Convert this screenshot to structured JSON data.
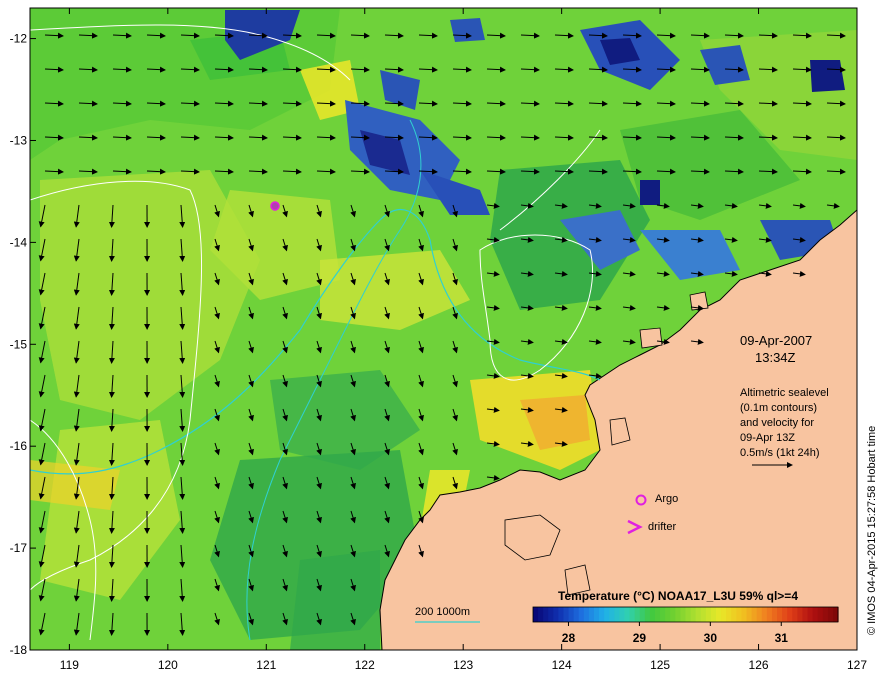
{
  "map": {
    "lon_ticks": [
      "119",
      "120",
      "121",
      "122",
      "123",
      "124",
      "125",
      "126",
      "127"
    ],
    "lat_ticks": [
      "-12",
      "-13",
      "-14",
      "-15",
      "-16",
      "-17",
      "-18"
    ],
    "lon_range": [
      118.6,
      127
    ],
    "lat_range": [
      -18,
      -11.7
    ]
  },
  "annotation": {
    "date": "09-Apr-2007",
    "time": "13:34Z",
    "info_lines": [
      "Altimetric sealevel",
      "(0.1m contours)",
      "and velocity for",
      "09-Apr 13Z",
      "0.5m/s (1kt 24h)"
    ]
  },
  "legend": {
    "argo_label": "Argo",
    "drifter_label": "drifter",
    "bathy_label": "200  1000m"
  },
  "colorbar": {
    "title": "Temperature (°C) NOAA17_L3U 59% ql>=4",
    "tick_labels": [
      "28",
      "29",
      "30",
      "31"
    ],
    "tick_values": [
      28,
      29,
      30,
      31
    ],
    "range": [
      27.5,
      31.8
    ]
  },
  "credit": "© IMOS 04-Apr-2015 15:27:58 Hobart time",
  "colors": {
    "land": "#f8c4a0",
    "ocean_green": "#3fc43a",
    "ocean_yellow": "#e6e62a",
    "ocean_lightgreen": "#9fdc3a",
    "cloud_blue": "#1e3ca0",
    "argo": "#e020e0",
    "bathy_200": "#30d0d0",
    "contour": "#ffffff"
  }
}
